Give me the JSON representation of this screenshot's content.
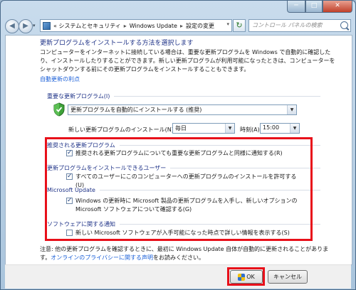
{
  "window": {
    "minimize": "─",
    "maximize": "□",
    "close": "✕"
  },
  "nav": {
    "back": "◀",
    "forward": "▶",
    "dropdown": "▾",
    "refresh": "↻"
  },
  "breadcrumb": {
    "prefix": "«",
    "seg1": "システムとセキュリティ",
    "seg2": "Windows Update",
    "seg3": "設定の変更",
    "separator": "▸",
    "chevron": "▾"
  },
  "search": {
    "placeholder": "コントロール パネルの検索"
  },
  "page": {
    "heading": "更新プログラムをインストールする方法を選択します",
    "intro": "コンピューターをインターネットに接続している場合は、重要な更新プログラムを Windows で自動的に確認したり、インストールしたりすることができます。新しい更新プログラムが利用可能になったときは、コンピューターをシャットダウンする前にその更新プログラムをインストールすることもできます。",
    "auto_update_link": "自動更新の利点"
  },
  "important": {
    "group_label": "重要な更新プログラム(I)",
    "mode": "更新プログラムを自動的にインストールする (推奨)",
    "schedule_label": "新しい更新プログラムのインストール(N):",
    "day": "毎日",
    "time_label": "時刻(A)",
    "time": "15:00"
  },
  "recommended": {
    "group_label": "推奨される更新プログラム",
    "checkbox": "推奨される更新プログラムについても重要な更新プログラムと同様に通知する(R)"
  },
  "who": {
    "group_label": "更新プログラムをインストールできるユーザー",
    "checkbox": "すべてのユーザーにこのコンピューターへの更新プログラムのインストールを許可する(U)"
  },
  "microsoft_update": {
    "group_label": "Microsoft Update",
    "checkbox": "Windows の更新時に Microsoft 製品の更新プログラムを入手し、新しいオプションの Microsoft ソフトウェアについて確認する(G)"
  },
  "software": {
    "group_label": "ソフトウェアに関する通知",
    "checkbox": "新しい Microsoft ソフトウェアが入手可能になった時点で詳しい情報を表示する(S)"
  },
  "note": {
    "text": "注意: 他の更新プログラムを確認するときに、最初に Windows Update 自体が自動的に更新されることがあります。",
    "privacy_link": "オンラインのプライバシーに関する声明",
    "suffix": "をお読みください。"
  },
  "buttons": {
    "ok": "OK",
    "cancel": "キャンセル"
  },
  "icons": {
    "address": "control-panel-icon",
    "shield": "shield-check-icon",
    "search": "search-icon",
    "uac": "uac-shield-icon"
  }
}
